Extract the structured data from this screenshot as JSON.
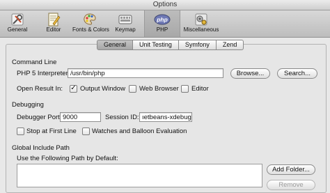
{
  "window": {
    "title": "Options"
  },
  "toolbar": {
    "items": [
      {
        "label": "General"
      },
      {
        "label": "Editor"
      },
      {
        "label": "Fonts & Colors"
      },
      {
        "label": "Keymap"
      },
      {
        "label": "PHP",
        "icon_text": "php"
      },
      {
        "label": "Miscellaneous"
      }
    ],
    "selected": "PHP"
  },
  "tabs": [
    "General",
    "Unit Testing",
    "Symfony",
    "Zend"
  ],
  "selected_tab": "General",
  "command_line": {
    "header": "Command Line",
    "interpreter_label": "PHP 5 Interpreter:",
    "interpreter_value": "/usr/bin/php",
    "browse_button": "Browse...",
    "search_button": "Search...",
    "open_result_label": "Open Result In:",
    "output_window": {
      "label": "Output Window",
      "checked": true
    },
    "web_browser": {
      "label": "Web Browser",
      "checked": false
    },
    "editor": {
      "label": "Editor",
      "checked": false
    }
  },
  "debugging": {
    "header": "Debugging",
    "port_label": "Debugger Port:",
    "port_value": "9000",
    "session_label": "Session ID:",
    "session_value": "ıetbeans-xdebug",
    "stop_first_line": {
      "label": "Stop at First Line",
      "checked": false
    },
    "watches": {
      "label": "Watches and Balloon Evaluation",
      "checked": false
    }
  },
  "include_path": {
    "header": "Global Include Path",
    "use_label": "Use the Following Path by Default:",
    "add_folder_button": "Add Folder...",
    "remove_button": "Remove"
  },
  "colors": {
    "background": "#e8e8e8",
    "field": "#ffffff",
    "php_icon": "#6f79b5"
  }
}
